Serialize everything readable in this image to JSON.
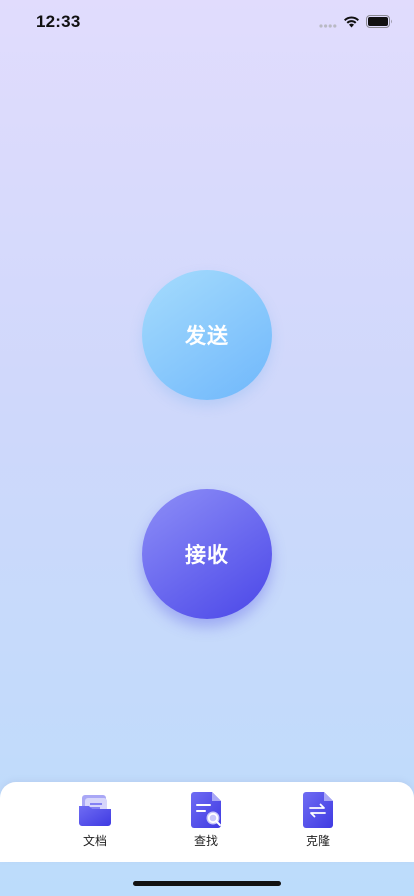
{
  "status_bar": {
    "time": "12:33",
    "icons": [
      "signal-icon",
      "wifi-icon",
      "battery-icon"
    ]
  },
  "main": {
    "send_label": "发送",
    "receive_label": "接收"
  },
  "tab_bar": {
    "items": [
      {
        "label": "文档",
        "icon": "folder-icon"
      },
      {
        "label": "查找",
        "icon": "search-document-icon"
      },
      {
        "label": "克隆",
        "icon": "transfer-document-icon"
      }
    ]
  },
  "colors": {
    "send_button": "#8ccbfc",
    "receive_button": "#5f5cef",
    "tab_icon": "#5a57ec",
    "background_top": "#e1dcfd",
    "background_bottom": "#bcdcfb"
  }
}
